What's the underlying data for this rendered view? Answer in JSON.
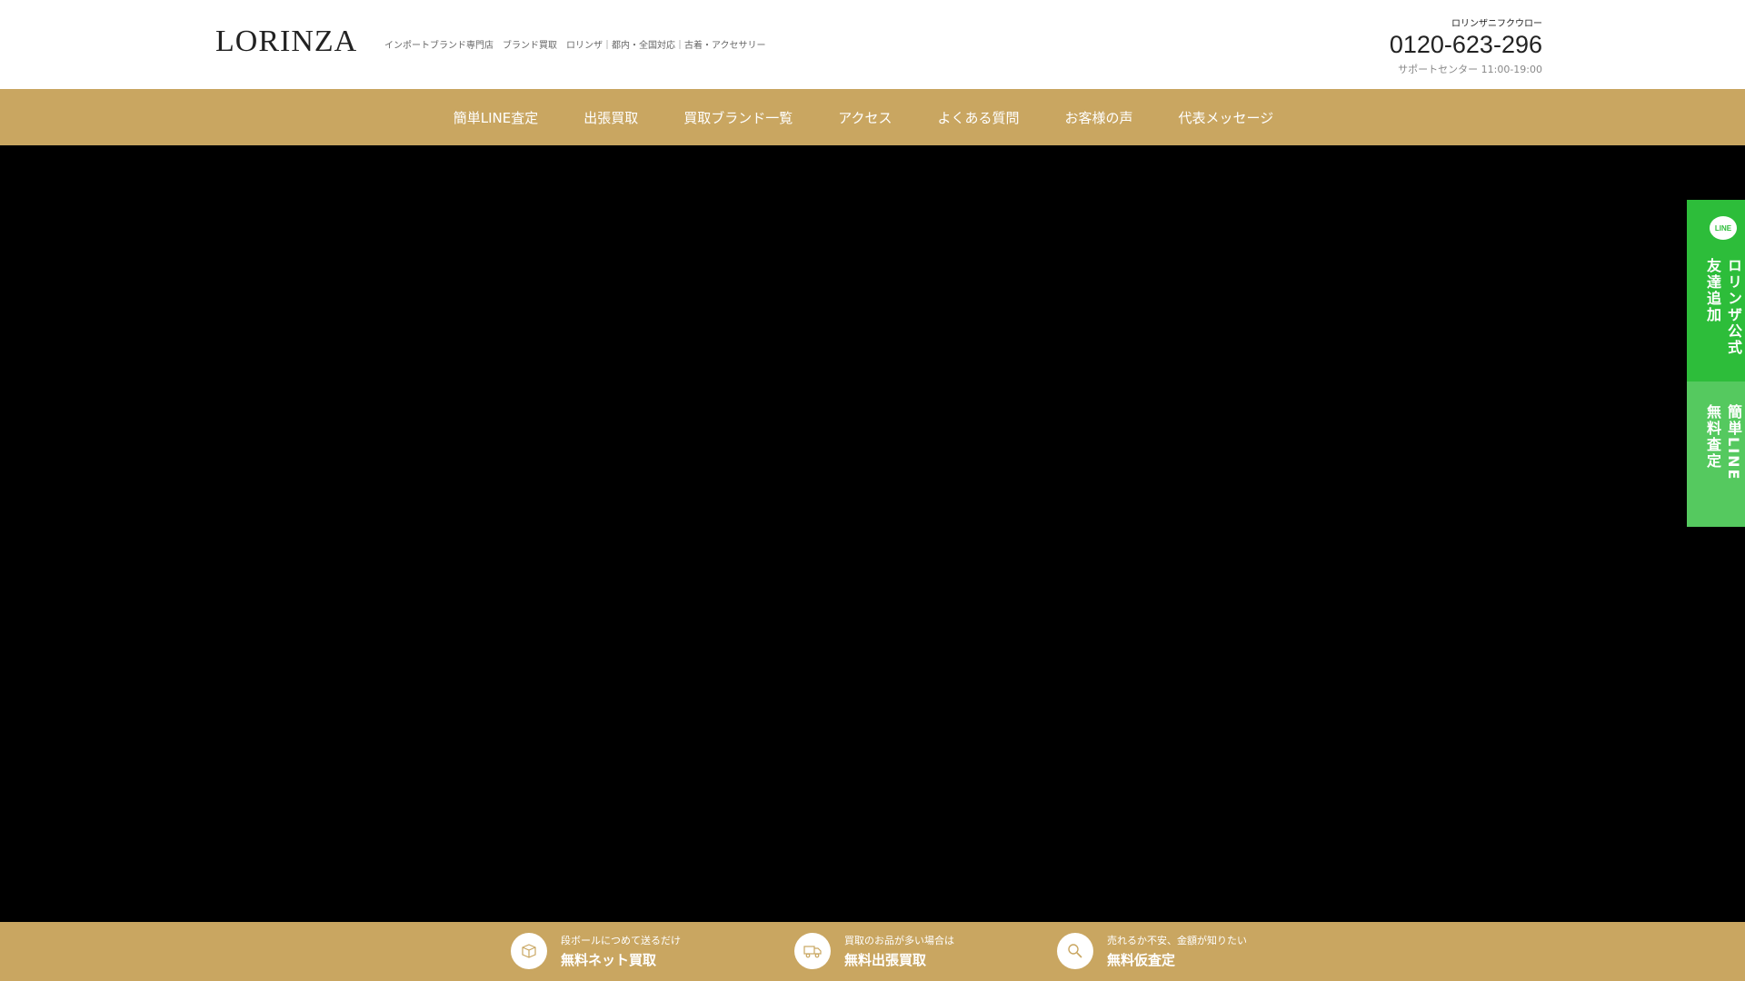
{
  "header": {
    "logo": "LORINZA",
    "tagline": "インポートブランド専門店　ブランド買取　ロリンザ｜都内・全国対応｜古着・アクセサリー",
    "phone_kana": "ロリンザニフクウロー",
    "phone": "0120-623-296",
    "hours": "サポートセンター 11:00-19:00"
  },
  "nav": {
    "items": [
      {
        "label": "簡単LINE査定"
      },
      {
        "label": "出張買取"
      },
      {
        "label": "買取ブランド一覧"
      },
      {
        "label": "アクセス"
      },
      {
        "label": "よくある質問"
      },
      {
        "label": "お客様の声"
      },
      {
        "label": "代表メッセージ"
      }
    ]
  },
  "side": {
    "line_badge": "LINE",
    "tab1_col1": "ロリンザ公式",
    "tab1_col2": "友達追加",
    "tab2_col1": "簡単LINE",
    "tab2_col2": "無料査定"
  },
  "bottom": {
    "ctas": [
      {
        "small": "段ボールにつめて送るだけ",
        "big": "無料ネット買取",
        "icon": "box-icon"
      },
      {
        "small": "買取のお品が多い場合は",
        "big": "無料出張買取",
        "icon": "truck-icon"
      },
      {
        "small": "売れるか不安、金額が知りたい",
        "big": "無料仮査定",
        "icon": "magnifier-icon"
      }
    ]
  },
  "colors": {
    "gold": "#c9a661",
    "line_green": "#2dbd3a",
    "line_green_light": "#55c95f",
    "hero": "#000000"
  }
}
